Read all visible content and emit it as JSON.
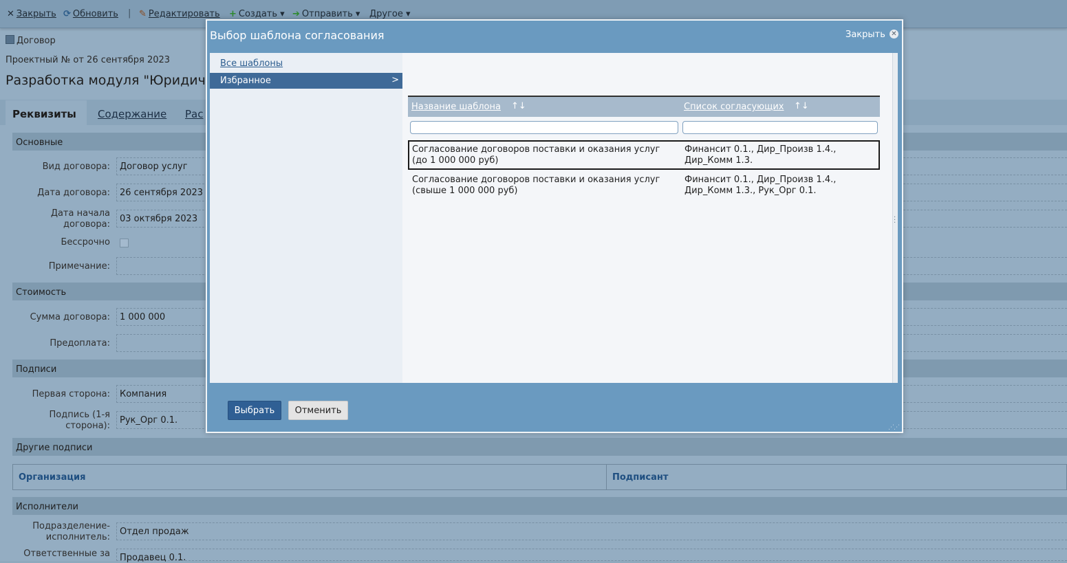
{
  "toolbar": {
    "close": "Закрыть",
    "refresh": "Обновить",
    "edit": "Редактировать",
    "create": "Создать ▾",
    "send": "Отправить ▾",
    "other": "Другое ▾"
  },
  "doc": {
    "type": "Договор",
    "number_line": "Проектный № от 26 сентября 2023",
    "title": "Разработка модуля \"Юридиче"
  },
  "tabs": [
    "Реквизиты",
    "Содержание",
    "Рас"
  ],
  "sections": {
    "main": "Основные",
    "cost": "Стоимость",
    "signatures": "Подписи",
    "other_signatures": "Другие подписи",
    "executors": "Исполнители"
  },
  "fields": {
    "contract_type": {
      "label": "Вид договора:",
      "value": "Договор услуг"
    },
    "contract_date": {
      "label": "Дата договора:",
      "value": "26 сентября 2023"
    },
    "start_date": {
      "label": "Дата начала договора:",
      "value": "03 октября 2023"
    },
    "perpetual": {
      "label": "Бессрочно"
    },
    "note": {
      "label": "Примечание:",
      "value": ""
    },
    "amount": {
      "label": "Сумма договора:",
      "value": "1 000 000"
    },
    "prepayment": {
      "label": "Предоплата:",
      "value": ""
    },
    "first_party": {
      "label": "Первая сторона:",
      "value": "Компания"
    },
    "first_signature": {
      "label": "Подпись (1-я сторона):",
      "value": "Рук_Орг 0.1."
    },
    "department": {
      "label": "Подразделение-исполнитель:",
      "value": "Отдел продаж"
    },
    "responsible": {
      "label": "Ответственные за",
      "value": "Продавец 0.1."
    }
  },
  "other_signatures_table": {
    "col_org": "Организация",
    "col_signer": "Подписант"
  },
  "modal": {
    "title": "Выбор шаблона согласования",
    "close_label": "Закрыть",
    "close_icon": "✕",
    "left_panel": {
      "all_templates": "Все шаблоны",
      "favorites": "Избранное",
      "favorites_chevron": ">"
    },
    "grid": {
      "col_name": "Название шаблона",
      "col_approvers": "Список согласующих",
      "sort_icon": "↑↓",
      "filter_name": "",
      "filter_approvers": "",
      "rows": [
        {
          "name_line1": "Согласование договоров поставки и оказания услуг",
          "name_line2": "(до 1 000 000 руб)",
          "approvers_line1": "Финансит 0.1., Дир_Произв 1.4.,",
          "approvers_line2": "Дир_Комм 1.3.",
          "selected": true
        },
        {
          "name_line1": "Согласование договоров поставки и оказания услуг",
          "name_line2": "(свыше 1 000 000 руб)",
          "approvers_line1": "Финансит 0.1., Дир_Произв 1.4.,",
          "approvers_line2": "Дир_Комм 1.3., Рук_Орг 0.1.",
          "selected": false
        }
      ]
    },
    "buttons": {
      "select": "Выбрать",
      "cancel": "Отменить"
    }
  },
  "colors": {
    "modal_header": "#6a9ac0",
    "selected_nav": "#3f6a98",
    "primary_button": "#2f5f94"
  }
}
